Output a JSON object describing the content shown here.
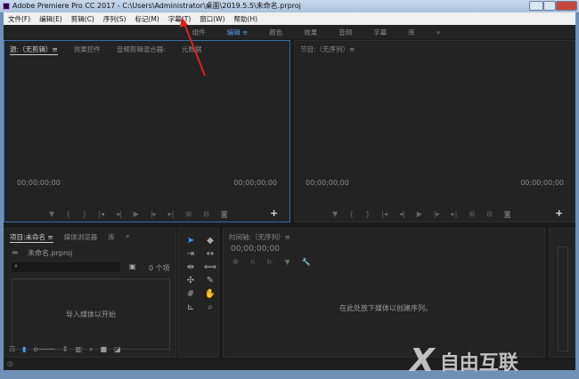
{
  "window": {
    "title": "Adobe Premiere Pro CC 2017 - C:\\Users\\Administrator\\桌面\\2019.5.5\\未命名.prproj"
  },
  "menu": [
    "文件(F)",
    "编辑(E)",
    "剪辑(C)",
    "序列(S)",
    "标记(M)",
    "字幕(T)",
    "窗口(W)",
    "帮助(H)"
  ],
  "workspaces": {
    "items": [
      "组件",
      "编辑",
      "颜色",
      "效果",
      "音频",
      "字幕",
      "库"
    ],
    "active": "编辑",
    "more": "»"
  },
  "source": {
    "tabs": [
      "源:（无剪辑）≡",
      "效果控件",
      "音频剪辑混合器:",
      "元数据"
    ],
    "tc_left": "00;00;00;00",
    "tc_right": "00;00;00;00"
  },
  "program": {
    "title": "节目:（无序列）≡",
    "tc_left": "00;00;00;00",
    "tc_right": "00;00;00;00"
  },
  "project": {
    "tabs": [
      "项目:未命名 ≡",
      "媒体浏览器",
      "库"
    ],
    "more": "»",
    "file": "未命名.prproj",
    "count": "0 个项",
    "empty": "导入媒体以开始",
    "search_placeholder": ""
  },
  "timeline": {
    "title": "时间轴:（无序列）≡",
    "tc": "00;00;00;00",
    "empty": "在此处放下媒体以创建序列。"
  },
  "watermark": {
    "text": "自由互联"
  },
  "colors": {
    "accent": "#4a9be8",
    "arrow": "#e02020"
  }
}
